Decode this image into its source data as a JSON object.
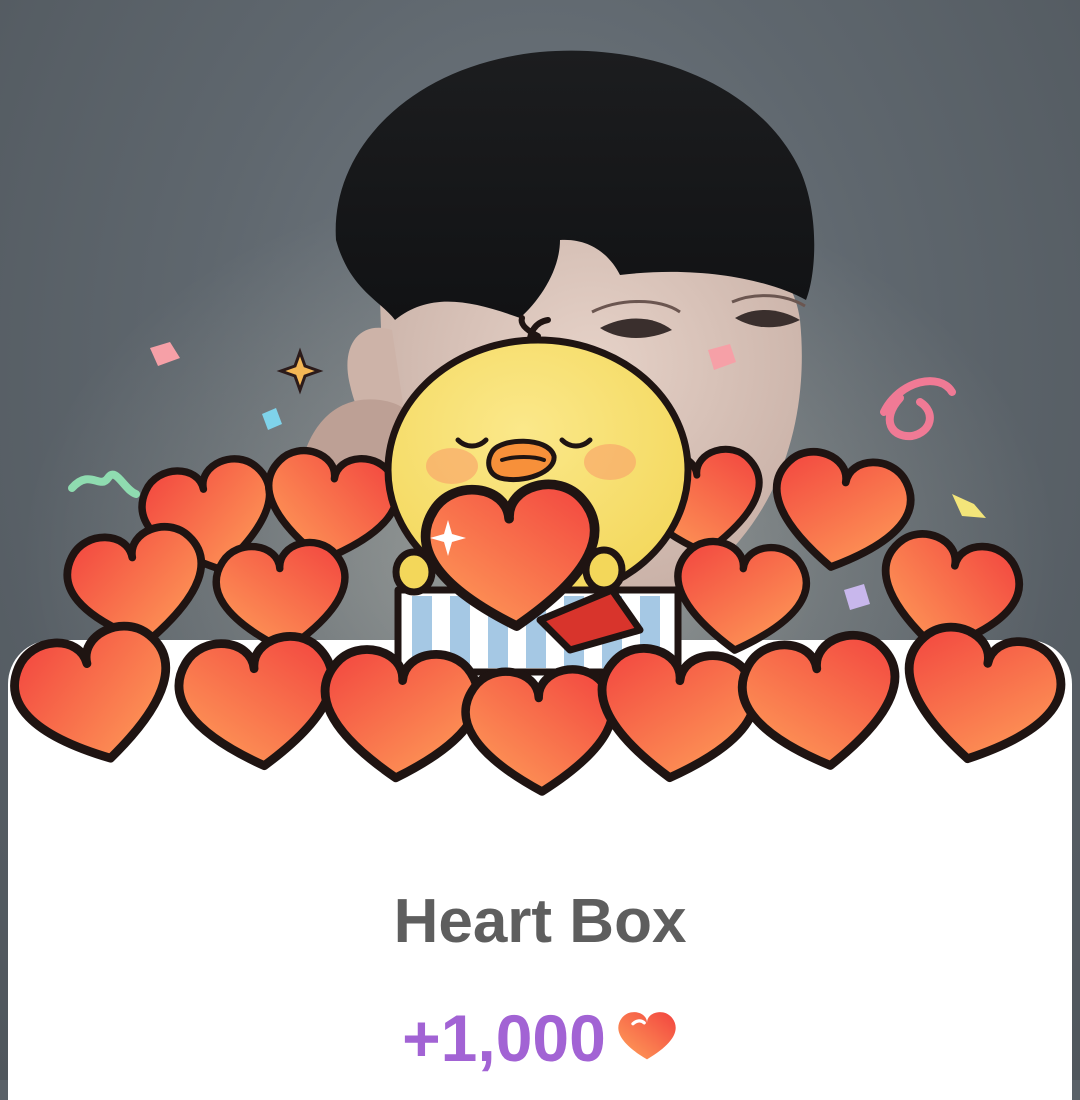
{
  "reward_card": {
    "title": "Heart Box",
    "amount": "+1,000",
    "currency_icon": "heart-icon"
  },
  "colors": {
    "title_text": "#5e5e5e",
    "amount_text": "#a263d4",
    "heart_light": "#ffa25a",
    "heart_dark": "#f2443f",
    "chick_yellow": "#f7de6a",
    "backdrop": "#5a6168"
  }
}
